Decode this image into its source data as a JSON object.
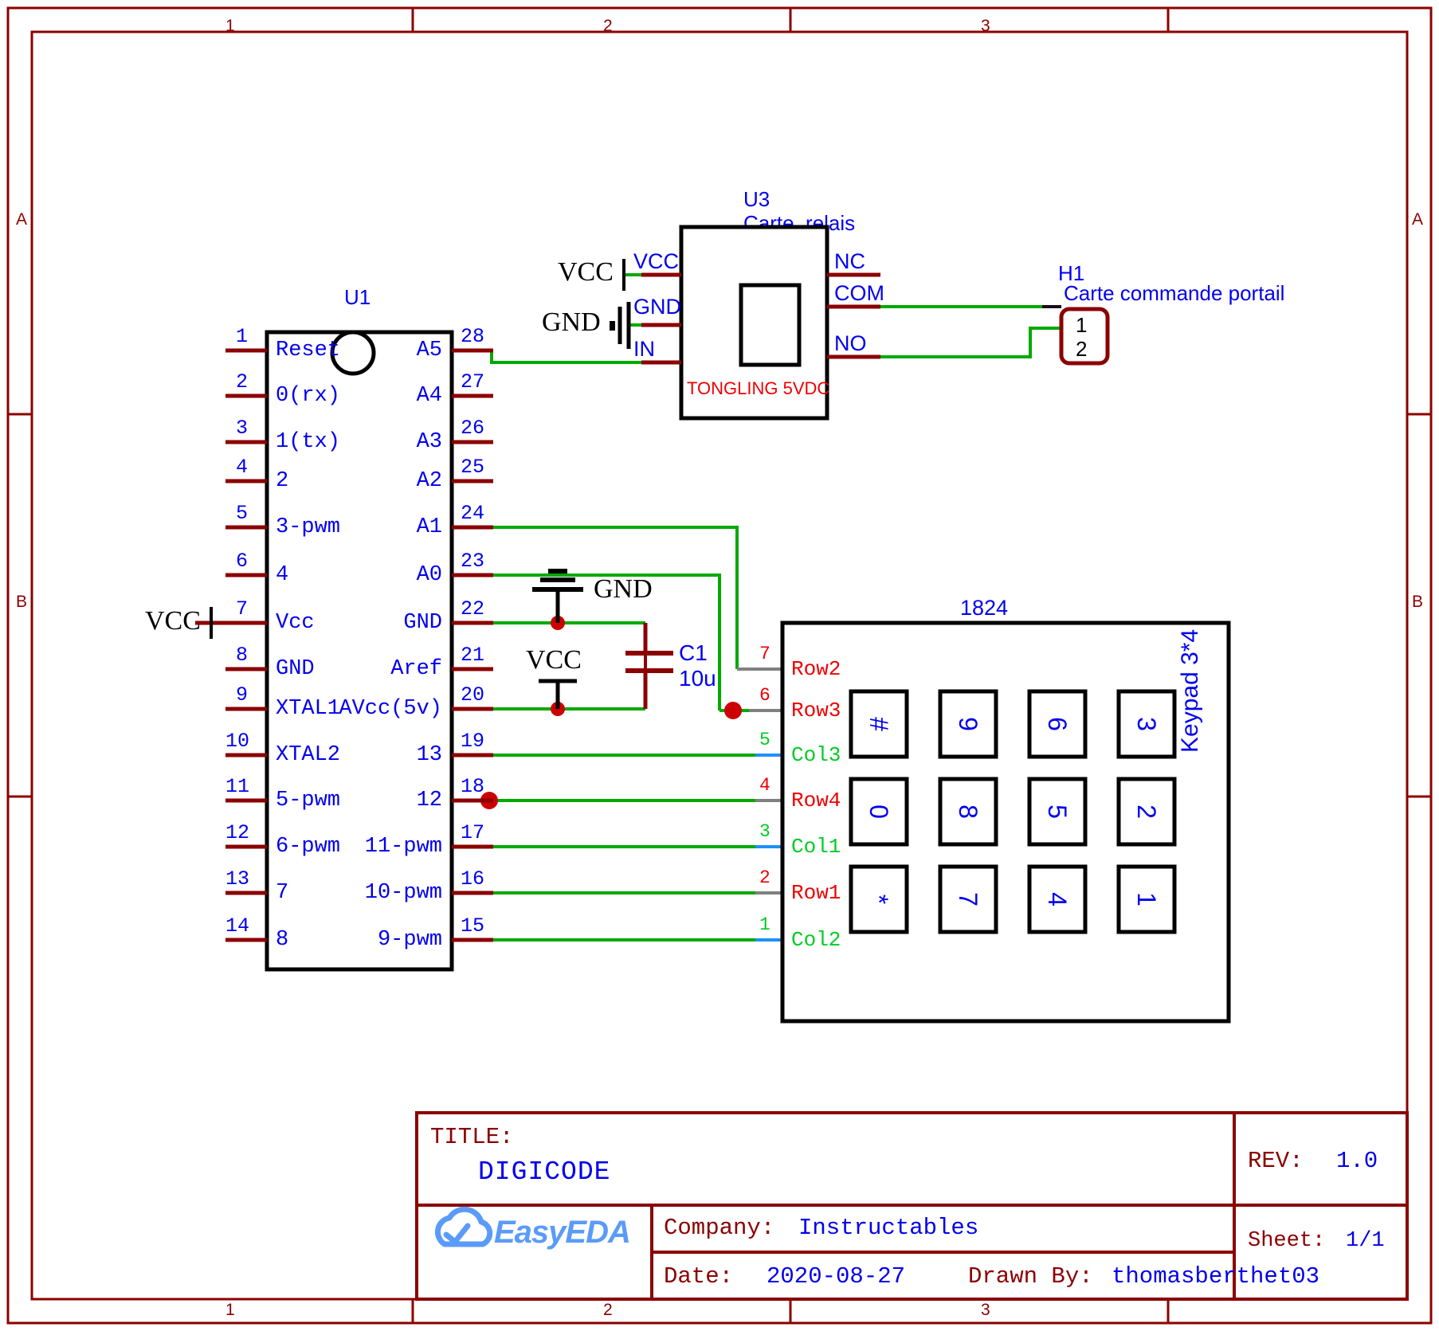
{
  "sheet": {
    "border_color": "#8b0000",
    "zone_cols": [
      "1",
      "2",
      "3"
    ],
    "zone_rows": [
      "A",
      "B"
    ]
  },
  "u1": {
    "ref": "U1",
    "left_pins": [
      {
        "num": "1",
        "name": "Reset"
      },
      {
        "num": "2",
        "name": "0(rx)"
      },
      {
        "num": "3",
        "name": "1(tx)"
      },
      {
        "num": "4",
        "name": "2"
      },
      {
        "num": "5",
        "name": "3-pwm"
      },
      {
        "num": "6",
        "name": "4"
      },
      {
        "num": "7",
        "name": "Vcc"
      },
      {
        "num": "8",
        "name": "GND"
      },
      {
        "num": "9",
        "name": "XTAL1"
      },
      {
        "num": "10",
        "name": "XTAL2"
      },
      {
        "num": "11",
        "name": "5-pwm"
      },
      {
        "num": "12",
        "name": "6-pwm"
      },
      {
        "num": "13",
        "name": "7"
      },
      {
        "num": "14",
        "name": "8"
      }
    ],
    "right_pins": [
      {
        "num": "28",
        "name": "A5"
      },
      {
        "num": "27",
        "name": "A4"
      },
      {
        "num": "26",
        "name": "A3"
      },
      {
        "num": "25",
        "name": "A2"
      },
      {
        "num": "24",
        "name": "A1"
      },
      {
        "num": "23",
        "name": "A0"
      },
      {
        "num": "22",
        "name": "GND"
      },
      {
        "num": "21",
        "name": "Aref"
      },
      {
        "num": "20",
        "name": "AVcc(5v)"
      },
      {
        "num": "19",
        "name": "13"
      },
      {
        "num": "18",
        "name": "12"
      },
      {
        "num": "17",
        "name": "11-pwm"
      },
      {
        "num": "16",
        "name": "10-pwm"
      },
      {
        "num": "15",
        "name": "9-pwm"
      }
    ],
    "vcc_net_label": "VCC"
  },
  "u3": {
    "ref": "U3",
    "name": "Carte_relais",
    "footer": "TONGLING 5VDC",
    "left_pins": [
      "VCC",
      "GND",
      "IN"
    ],
    "right_pins": [
      "NC",
      "COM",
      "NO"
    ],
    "vcc_net_label": "VCC",
    "gnd_net_label": "GND"
  },
  "h1": {
    "ref": "H1",
    "name": "Carte commande portail",
    "pins": [
      "1",
      "2"
    ]
  },
  "c1": {
    "ref": "C1",
    "value": "10u",
    "gnd_label": "GND",
    "vcc_label": "VCC"
  },
  "keypad": {
    "ref": "1824",
    "side_label": "Keypad 3*4",
    "pins": [
      {
        "num": "7",
        "name": "Row2",
        "kind": "row"
      },
      {
        "num": "6",
        "name": "Row3",
        "kind": "row"
      },
      {
        "num": "5",
        "name": "Col3",
        "kind": "col"
      },
      {
        "num": "4",
        "name": "Row4",
        "kind": "row"
      },
      {
        "num": "3",
        "name": "Col1",
        "kind": "col"
      },
      {
        "num": "2",
        "name": "Row1",
        "kind": "row"
      },
      {
        "num": "1",
        "name": "Col2",
        "kind": "col"
      }
    ],
    "keys": [
      [
        "#",
        "9",
        "6",
        "3"
      ],
      [
        "0",
        "8",
        "5",
        "2"
      ],
      [
        "*",
        "7",
        "4",
        "1"
      ]
    ]
  },
  "title_block": {
    "title_label": "TITLE:",
    "title_value": "DIGICODE",
    "rev_label": "REV:",
    "rev_value": "1.0",
    "company_label": "Company:",
    "company_value": "Instructables",
    "sheet_label": "Sheet:",
    "sheet_value": "1/1",
    "date_label": "Date:",
    "date_value": "2020-08-27",
    "drawn_label": "Drawn By:",
    "drawn_value": "thomasberthet03",
    "logo_text": "EasyEDA"
  }
}
